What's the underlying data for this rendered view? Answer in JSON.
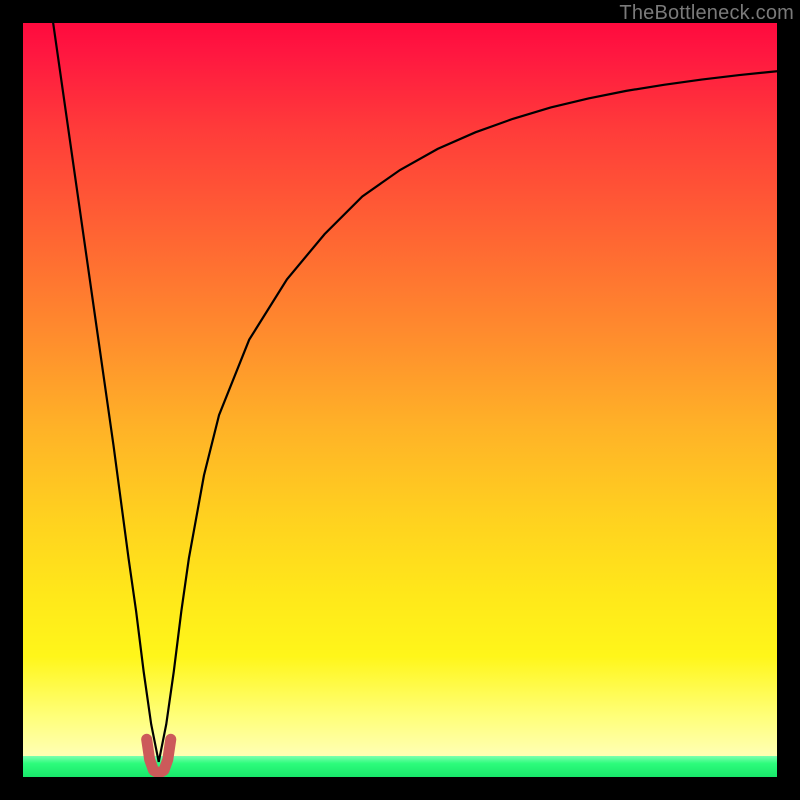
{
  "watermark": "TheBottleneck.com",
  "chart_data": {
    "type": "line",
    "title": "",
    "xlabel": "",
    "ylabel": "",
    "xlim": [
      0,
      100
    ],
    "ylim": [
      0,
      100
    ],
    "grid": false,
    "legend": false,
    "notes": "Background is a vertical gradient red→yellow→green indicating bottleneck severity; the black curve shows mismatch vs. an x-axis parameter, with a minimum (≈0) near x≈18. A short pink/red U-shaped marker sits at the curve's minimum.",
    "series": [
      {
        "name": "bottleneck-curve",
        "color": "#000000",
        "x": [
          4,
          6,
          8,
          10,
          12,
          14,
          15,
          16,
          17,
          18,
          19,
          20,
          21,
          22,
          24,
          26,
          30,
          35,
          40,
          45,
          50,
          55,
          60,
          65,
          70,
          75,
          80,
          85,
          90,
          95,
          100
        ],
        "y": [
          100,
          86,
          72,
          58,
          44,
          29,
          22,
          14,
          7,
          2,
          7,
          14,
          22,
          29,
          40,
          48,
          58,
          66,
          72,
          77,
          80.5,
          83.3,
          85.5,
          87.3,
          88.8,
          90.0,
          91.0,
          91.8,
          92.5,
          93.1,
          93.6
        ]
      },
      {
        "name": "min-marker",
        "color": "#cc5a5a",
        "x": [
          16.4,
          16.8,
          17.3,
          18.0,
          18.7,
          19.2,
          19.6
        ],
        "y": [
          5.0,
          2.3,
          0.9,
          0.5,
          0.9,
          2.3,
          5.0
        ]
      }
    ],
    "background_gradient_stops": [
      {
        "pos": 0.0,
        "color": "#ff0a3e"
      },
      {
        "pos": 0.3,
        "color": "#ff6a32"
      },
      {
        "pos": 0.66,
        "color": "#ffd21f"
      },
      {
        "pos": 0.92,
        "color": "#ffff7a"
      },
      {
        "pos": 0.972,
        "color": "#7dffb0"
      },
      {
        "pos": 1.0,
        "color": "#18e76a"
      }
    ]
  }
}
